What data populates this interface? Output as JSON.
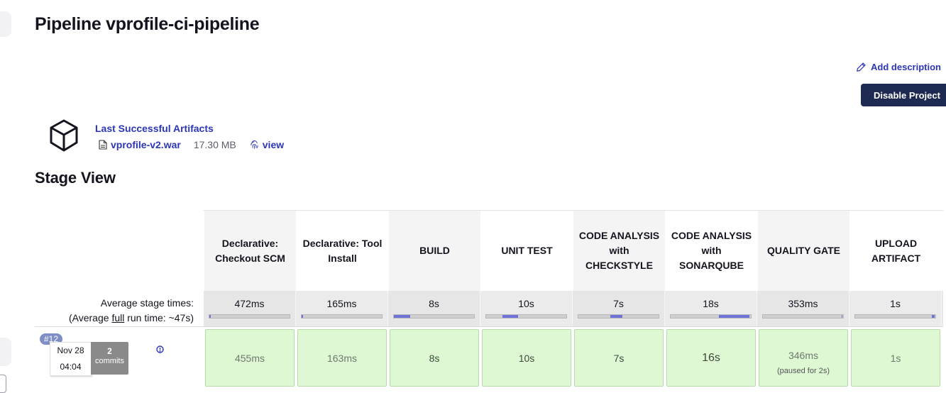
{
  "page": {
    "title": "Pipeline vprofile-ci-pipeline",
    "add_description": "Add description",
    "disable_project": "Disable Project"
  },
  "artifacts": {
    "heading": "Last Successful Artifacts",
    "file_name": "vprofile-v2.war",
    "file_size": "17.30 MB",
    "view": "view"
  },
  "stage_view": {
    "heading": "Stage View",
    "avg_label_line1": "Average stage times:",
    "avg_label_pre": "(Average ",
    "avg_label_link": "full",
    "avg_label_post": " run time: ~47s)",
    "stages": [
      {
        "name": "Declarative: Checkout SCM",
        "avg": "472ms",
        "bar_start": 0.0,
        "bar_fraction": 0.01
      },
      {
        "name": "Declarative: Tool Install",
        "avg": "165ms",
        "bar_start": 0.0,
        "bar_fraction": 0.01
      },
      {
        "name": "BUILD",
        "avg": "8s",
        "bar_start": 0.0,
        "bar_fraction": 0.2
      },
      {
        "name": "UNIT TEST",
        "avg": "10s",
        "bar_start": 0.2,
        "bar_fraction": 0.2
      },
      {
        "name": "CODE ANALYSIS with CHECKSTYLE",
        "avg": "7s",
        "bar_start": 0.4,
        "bar_fraction": 0.15
      },
      {
        "name": "CODE ANALYSIS with SONARQUBE",
        "avg": "18s",
        "bar_start": 0.6,
        "bar_fraction": 0.38
      },
      {
        "name": "QUALITY GATE",
        "avg": "353ms",
        "bar_start": 0.98,
        "bar_fraction": 0.01
      },
      {
        "name": "UPLOAD ARTIFACT",
        "avg": "1s",
        "bar_start": 0.96,
        "bar_fraction": 0.03
      }
    ],
    "build": {
      "number": "#12",
      "date": "Nov 28",
      "time": "04:04",
      "commit_count": "2",
      "commit_label": "commits",
      "cells": [
        {
          "time": "455ms",
          "note": ""
        },
        {
          "time": "163ms",
          "note": ""
        },
        {
          "time": "8s",
          "note": ""
        },
        {
          "time": "10s",
          "note": ""
        },
        {
          "time": "7s",
          "note": ""
        },
        {
          "time": "16s",
          "note": ""
        },
        {
          "time": "346ms",
          "note": "(paused for 2s)"
        },
        {
          "time": "1s",
          "note": ""
        }
      ]
    }
  },
  "colors": {
    "link": "#2b35b8",
    "button_bg": "#1e2a52",
    "success_cell": "#dff8d4",
    "bar_fill": "#6f72d6",
    "badge": "#7d8ec6"
  }
}
